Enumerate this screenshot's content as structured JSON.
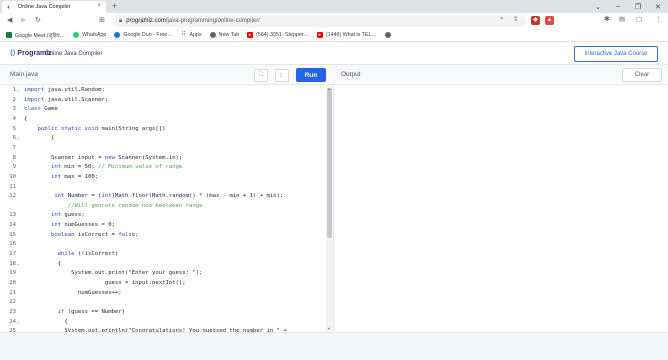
{
  "browser": {
    "tab_title": "Online Java Compiler",
    "tab_close": "×",
    "new_tab": "+",
    "url_host": "programiz.com",
    "url_path": "/java-programming/online-compiler/"
  },
  "bookmarks": [
    {
      "label": "Google Meet (जुड़िए…",
      "icon": "google-meet-icon",
      "color": "#188038"
    },
    {
      "label": "WhatsApp",
      "icon": "whatsapp-icon",
      "color": "#25d366"
    },
    {
      "label": "Google Duo - Free…",
      "icon": "google-duo-icon",
      "color": "#1a73e8"
    },
    {
      "label": "Apps",
      "icon": "apps-grid-icon",
      "color": "#5f6368"
    },
    {
      "label": "New Tab",
      "icon": "globe-icon",
      "color": "#5f6368"
    },
    {
      "label": "(564) 3051- Stepper…",
      "icon": "youtube-icon",
      "color": "#ff0000"
    },
    {
      "label": "(1446) What is TEL…",
      "icon": "youtube-icon",
      "color": "#ff0000"
    },
    {
      "label": "",
      "icon": "globe-icon",
      "color": "#5f6368"
    }
  ],
  "site": {
    "logo": "Programiz",
    "title": "Online Java Compiler",
    "cta": "Interactive Java Course"
  },
  "editor": {
    "filename": "Main.java",
    "run_label": "Run",
    "output_label": "Output",
    "clear_label": "Clear"
  },
  "code_lines": [
    {
      "n": "1",
      "fold": "▾",
      "text": "import java.util.Random;"
    },
    {
      "n": "2",
      "fold": "",
      "text": "import java.util.Scanner;"
    },
    {
      "n": "3",
      "fold": "",
      "text": "class Game"
    },
    {
      "n": "4",
      "fold": "",
      "text": "{"
    },
    {
      "n": "5",
      "fold": "",
      "text": "    public static void main(String args[])"
    },
    {
      "n": "6",
      "fold": "▾",
      "text": "        {"
    },
    {
      "n": "7",
      "fold": "",
      "text": ""
    },
    {
      "n": "8",
      "fold": "",
      "text": "        Scanner input = new Scanner(System.in);"
    },
    {
      "n": "9",
      "fold": "",
      "text": "        int min = 50; // Minimum value of range"
    },
    {
      "n": "10",
      "fold": "",
      "text": "        int max = 100;"
    },
    {
      "n": "11",
      "fold": "",
      "text": ""
    },
    {
      "n": "12",
      "fold": "",
      "text": "         int Number = (int)Math.floor(Math.random() * (max - min + 1) + min);"
    },
    {
      "n": "",
      "fold": "",
      "text": "             //Will genrate random noo beetween range"
    },
    {
      "n": "13",
      "fold": "",
      "text": "        int guess;"
    },
    {
      "n": "14",
      "fold": "",
      "text": "        int numGuesses = 0;"
    },
    {
      "n": "15",
      "fold": "",
      "text": "        boolean isCorrect = false;"
    },
    {
      "n": "16",
      "fold": "",
      "text": ""
    },
    {
      "n": "17",
      "fold": "",
      "text": "          while (!isCorrect)"
    },
    {
      "n": "18",
      "fold": "▾",
      "text": "          {"
    },
    {
      "n": "19",
      "fold": "",
      "text": "              System.out.print(\"Enter your guess: \");"
    },
    {
      "n": "20",
      "fold": "",
      "text": "                        guess = input.nextInt();"
    },
    {
      "n": "21",
      "fold": "",
      "text": "                numGuesses++;"
    },
    {
      "n": "22",
      "fold": "",
      "text": ""
    },
    {
      "n": "23",
      "fold": "",
      "text": "          if (guess == Number)"
    },
    {
      "n": "24",
      "fold": "▾",
      "text": "            {"
    },
    {
      "n": "25",
      "fold": "",
      "text": "            System.out.println(\"Congratulations! You guessed the number in \" +"
    }
  ]
}
